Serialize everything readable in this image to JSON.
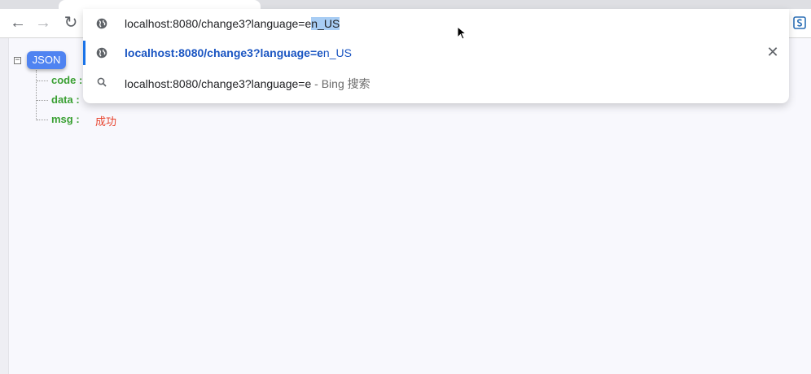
{
  "browser": {
    "nav_back": "←",
    "nav_forward": "→",
    "nav_reload": "↻"
  },
  "omnibox": {
    "input_prefix": "localhost:8080/change3?language=e",
    "input_selected": "n_US",
    "suggestions": [
      {
        "icon": "globe-icon",
        "bold_text": "localhost:8080/change3?language=e",
        "plain_text": "n_US",
        "remove": "✕"
      },
      {
        "icon": "search-icon",
        "text": "localhost:8080/change3?language=e",
        "suffix": " - Bing 搜索"
      }
    ]
  },
  "json_view": {
    "badge": "JSON",
    "collapse": "−",
    "keys": [
      "code :",
      "data :",
      "msg :"
    ],
    "msg_value": "成功"
  }
}
